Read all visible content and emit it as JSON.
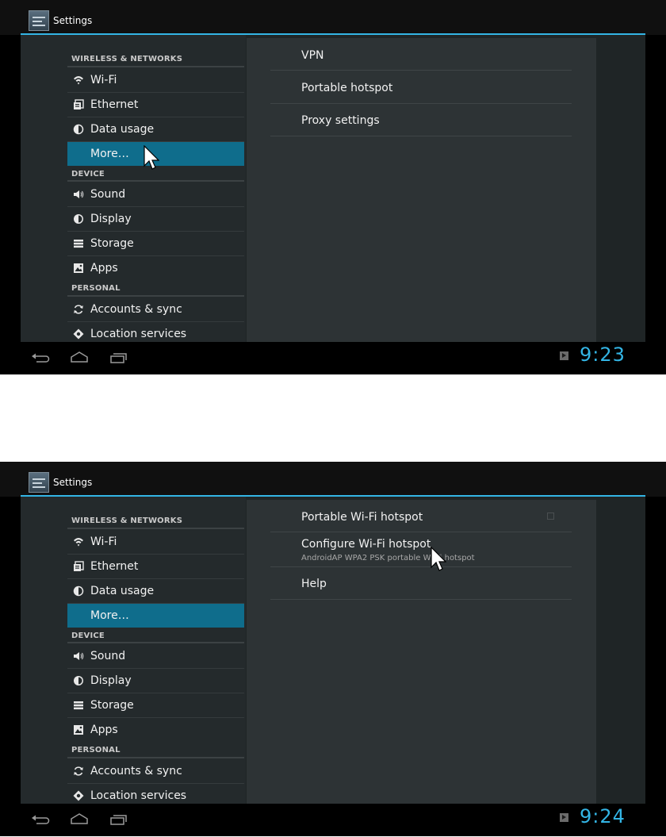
{
  "screenshots": [
    {
      "app_title": "Settings",
      "sidebar": {
        "sections": [
          {
            "header": "WIRELESS & NETWORKS",
            "items": [
              {
                "label": "Wi-Fi",
                "icon": "wifi-icon"
              },
              {
                "label": "Ethernet",
                "icon": "ethernet-icon"
              },
              {
                "label": "Data usage",
                "icon": "data-usage-icon"
              },
              {
                "label": "More…",
                "icon": "",
                "selected": true
              }
            ]
          },
          {
            "header": "DEVICE",
            "items": [
              {
                "label": "Sound",
                "icon": "sound-icon"
              },
              {
                "label": "Display",
                "icon": "display-icon"
              },
              {
                "label": "Storage",
                "icon": "storage-icon"
              },
              {
                "label": "Apps",
                "icon": "apps-icon"
              }
            ]
          },
          {
            "header": "PERSONAL",
            "items": [
              {
                "label": "Accounts & sync",
                "icon": "sync-icon"
              },
              {
                "label": "Location services",
                "icon": "location-icon"
              }
            ]
          }
        ]
      },
      "detail_items": [
        {
          "title": "VPN"
        },
        {
          "title": "Portable hotspot"
        },
        {
          "title": "Proxy settings"
        }
      ],
      "clock": "9:23"
    },
    {
      "app_title": "Settings",
      "sidebar": {
        "sections": [
          {
            "header": "WIRELESS & NETWORKS",
            "items": [
              {
                "label": "Wi-Fi",
                "icon": "wifi-icon"
              },
              {
                "label": "Ethernet",
                "icon": "ethernet-icon"
              },
              {
                "label": "Data usage",
                "icon": "data-usage-icon"
              },
              {
                "label": "More…",
                "icon": "",
                "selected": true
              }
            ]
          },
          {
            "header": "DEVICE",
            "items": [
              {
                "label": "Sound",
                "icon": "sound-icon"
              },
              {
                "label": "Display",
                "icon": "display-icon"
              },
              {
                "label": "Storage",
                "icon": "storage-icon"
              },
              {
                "label": "Apps",
                "icon": "apps-icon"
              }
            ]
          },
          {
            "header": "PERSONAL",
            "items": [
              {
                "label": "Accounts & sync",
                "icon": "sync-icon"
              },
              {
                "label": "Location services",
                "icon": "location-icon"
              }
            ]
          }
        ]
      },
      "detail_items": [
        {
          "title": "Portable Wi-Fi hotspot",
          "checkbox": true,
          "checked": false
        },
        {
          "title": "Configure Wi-Fi hotspot",
          "summary": "AndroidAP WPA2 PSK portable Wi-Fi hotspot"
        },
        {
          "title": "Help"
        }
      ],
      "clock": "9:24"
    }
  ],
  "colors": {
    "accent": "#33b5e5",
    "selected_item": "#0f6d8c",
    "background": "#000000"
  }
}
